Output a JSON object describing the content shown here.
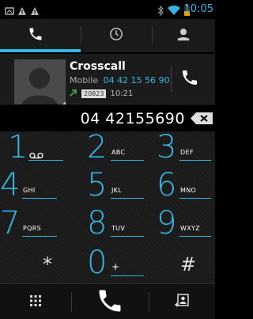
{
  "status_bar": {
    "time": "10:05",
    "accent_color": "#33b5e5"
  },
  "tabs": [
    {
      "icon": "phone-icon",
      "active": true
    },
    {
      "icon": "clock-icon",
      "active": false
    },
    {
      "icon": "person-icon",
      "active": false
    }
  ],
  "contact": {
    "name": "Crosscall",
    "number_type": "Mobile",
    "number": "04 42 15 56 90",
    "call_badge": "20823",
    "time": "10:21"
  },
  "dialer": {
    "digits": "04 42155690"
  },
  "keypad": {
    "keys": [
      {
        "digit": "1",
        "letters": ""
      },
      {
        "digit": "2",
        "letters": "ABC"
      },
      {
        "digit": "3",
        "letters": "DEF"
      },
      {
        "digit": "4",
        "letters": "GHI"
      },
      {
        "digit": "5",
        "letters": "JKL"
      },
      {
        "digit": "6",
        "letters": "MNO"
      },
      {
        "digit": "7",
        "letters": "PQRS"
      },
      {
        "digit": "8",
        "letters": "TUV"
      },
      {
        "digit": "9",
        "letters": "WXYZ"
      }
    ],
    "star": "*",
    "zero": "0",
    "plus": "+",
    "hash": "#"
  },
  "bottom_bar": [
    {
      "icon": "dialpad-icon"
    },
    {
      "icon": "call-icon"
    },
    {
      "icon": "add-contact-icon"
    }
  ]
}
